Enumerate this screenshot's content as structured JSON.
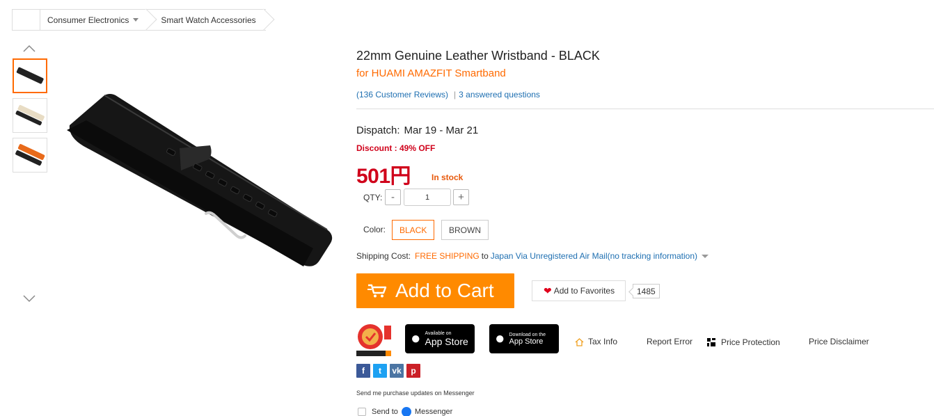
{
  "breadcrumb": {
    "items": [
      {
        "label": "Consumer Electronics"
      },
      {
        "label": "Smart Watch Accessories"
      }
    ]
  },
  "product": {
    "title": "22mm Genuine Leather Wristband  -  BLACK",
    "subtitle": "for HUAMI AMAZFIT Smartband",
    "reviews": "(136 Customer Reviews)",
    "reviews_separator": "|",
    "answered": "3 answered questions",
    "dispatch_label": "Dispatch:",
    "dispatch_dates": "Mar 19 - Mar 21",
    "discount": "Discount : 49% OFF",
    "price": "501円",
    "stock": "In stock",
    "qty_label": "QTY:",
    "qty_value": "1",
    "qty_minus": "-",
    "qty_plus": "+",
    "color_label": "Color:",
    "colors": [
      "BLACK",
      "BROWN"
    ],
    "shipping_label": "Shipping Cost:",
    "shipping_free": "FREE SHIPPING",
    "shipping_to": "to",
    "shipping_via": "Japan Via Unregistered Air Mail(no tracking information)",
    "add_to_cart": "Add to Cart",
    "add_to_favorites": "Add to Favorites",
    "favorites_count": "1485"
  },
  "stores": {
    "a_small": "Available on",
    "a_big": "App Store",
    "b_small": "Download on the",
    "b_big": "App Store"
  },
  "utility_links": {
    "tax": "Tax Info",
    "report": "Report Error",
    "price_protection": "Price Protection",
    "disclaimer": "Price Disclaimer"
  },
  "social": {
    "fb": "f",
    "tw": "t",
    "vk": "vk",
    "pi": "p"
  },
  "messenger": {
    "note": "Send me purchase updates on Messenger",
    "send_to": "Send to",
    "name": "Messenger"
  },
  "colors": {
    "accent": "#ff6a00",
    "price": "#d0021b",
    "link": "#1e6fb1",
    "cart": "#ff8a00"
  }
}
